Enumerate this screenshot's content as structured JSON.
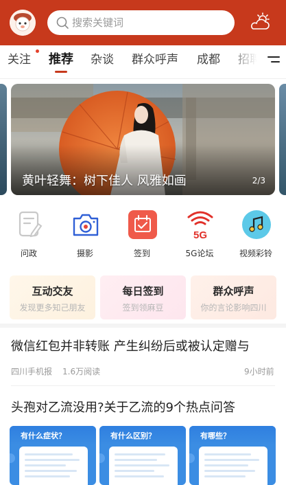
{
  "search": {
    "placeholder": "搜索关键词"
  },
  "tabs": [
    {
      "label": "关注"
    },
    {
      "label": "推荐"
    },
    {
      "label": "杂谈"
    },
    {
      "label": "群众呼声"
    },
    {
      "label": "成都"
    },
    {
      "label": "招聘"
    }
  ],
  "banner": {
    "title": "黄叶轻舞：树下佳人 风雅如画",
    "page": "2/3"
  },
  "quick_links": [
    {
      "label": "问政",
      "icon": "document-pen-icon"
    },
    {
      "label": "摄影",
      "icon": "camera-icon"
    },
    {
      "label": "签到",
      "icon": "calendar-check-icon"
    },
    {
      "label": "5G论坛",
      "icon": "5g-signal-icon"
    },
    {
      "label": "视频彩铃",
      "icon": "music-note-icon"
    }
  ],
  "feature_cards": [
    {
      "title": "互动交友",
      "subtitle": "发现更多知己朋友"
    },
    {
      "title": "每日签到",
      "subtitle": "签到领麻豆"
    },
    {
      "title": "群众呼声",
      "subtitle": "你的言论影响四川"
    }
  ],
  "news": [
    {
      "title": "微信红包并非转账 产生纠纷后或被认定赠与",
      "source": "四川手机报",
      "reads": "1.6万阅读",
      "time": "9小时前"
    },
    {
      "title": "头孢对乙流没用?关于乙流的9个热点问答"
    }
  ],
  "thumbnails": [
    {
      "heading": "有什么症状？"
    },
    {
      "heading": "有什么区别？"
    },
    {
      "heading": "有哪些？"
    }
  ],
  "colors": {
    "brand": "#c7391c",
    "accent_dot": "#e4412b"
  }
}
